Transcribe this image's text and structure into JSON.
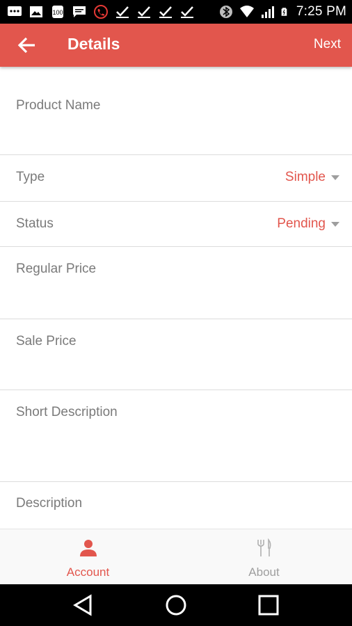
{
  "status_bar": {
    "time": "7:25 PM",
    "left_icons": [
      "message-icon",
      "image-icon",
      "app-icon",
      "message-icon",
      "call-icon",
      "check-icon",
      "check-icon",
      "check-icon",
      "check-icon"
    ],
    "right_icons": [
      "bluetooth-icon",
      "wifi-icon",
      "signal-icon",
      "battery-icon"
    ]
  },
  "app_bar": {
    "title": "Details",
    "next_label": "Next",
    "color": "#e2564d"
  },
  "form": {
    "product_name_label": "Product Name",
    "type_label": "Type",
    "type_value": "Simple",
    "status_label": "Status",
    "status_value": "Pending",
    "regular_price_label": "Regular Price",
    "sale_price_label": "Sale Price",
    "short_description_label": "Short Description",
    "description_label": "Description"
  },
  "bottom_nav": {
    "account_label": "Account",
    "about_label": "About",
    "active": "account",
    "active_color": "#e2564d",
    "inactive_color": "#9e9e9e"
  }
}
